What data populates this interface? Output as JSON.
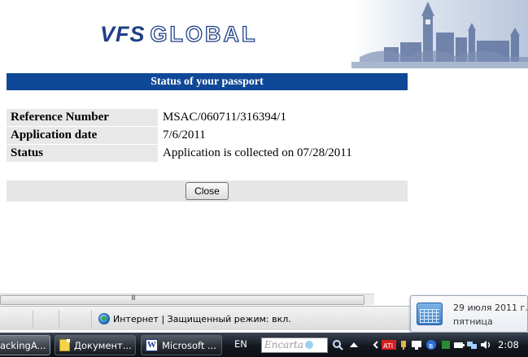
{
  "header": {
    "logo_vfs": "VFS",
    "logo_global": "GLOBAL"
  },
  "panel": {
    "title": "Status of your passport",
    "rows": [
      {
        "label": "Reference Number",
        "value": "MSAC/060711/316394/1"
      },
      {
        "label": "Application date",
        "value": "7/6/2011"
      },
      {
        "label": "Status",
        "value": "Application is collected on 07/28/2011"
      }
    ],
    "close_label": "Close"
  },
  "browser": {
    "scroll_grip": "III",
    "zone_text": "Интернет | Защищенный режим: вкл."
  },
  "datepopup": {
    "date": "29 июля 2011 г.",
    "weekday": "пятница"
  },
  "taskbar": {
    "tasks": [
      {
        "label": "ackingA...",
        "icon": "ie-icon"
      },
      {
        "label": "Документ...",
        "icon": "folder-icon"
      },
      {
        "label": "Microsoft ...",
        "icon": "word-icon"
      }
    ],
    "language": "EN",
    "encarta_text": "Encarta",
    "clock": "2:08"
  },
  "colors": {
    "title_bar": "#0f4897",
    "logo_blue": "#1d3f86",
    "label_bg": "#e8e8e8"
  }
}
